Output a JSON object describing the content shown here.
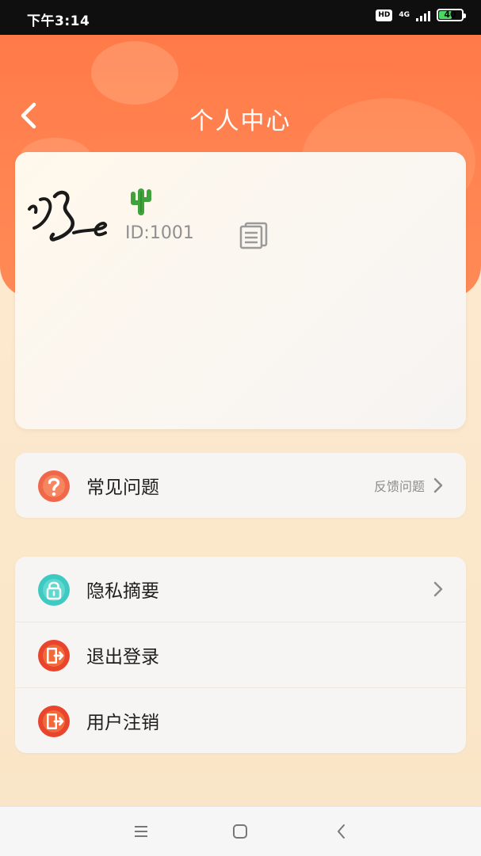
{
  "status_bar": {
    "time": "下午3:14",
    "hd": "HD",
    "network": "4G",
    "battery_level": "40"
  },
  "header": {
    "title": "个人中心"
  },
  "profile": {
    "user_id": "ID:1001",
    "status_icon": "cactus-icon"
  },
  "menu_group_1": [
    {
      "label": "常见问题",
      "hint": "反馈问题",
      "icon": "question-icon"
    }
  ],
  "menu_group_2": [
    {
      "label": "隐私摘要",
      "icon": "privacy-lock-icon"
    },
    {
      "label": "退出登录",
      "icon": "logout-icon"
    },
    {
      "label": "用户注销",
      "icon": "account-delete-icon"
    }
  ],
  "colors": {
    "header": "#ff7a48",
    "background": "#fdebd3",
    "logout_icon": "#e8452c",
    "privacy_icon": "#3ec9c2",
    "question_icon": "#f0674a"
  }
}
